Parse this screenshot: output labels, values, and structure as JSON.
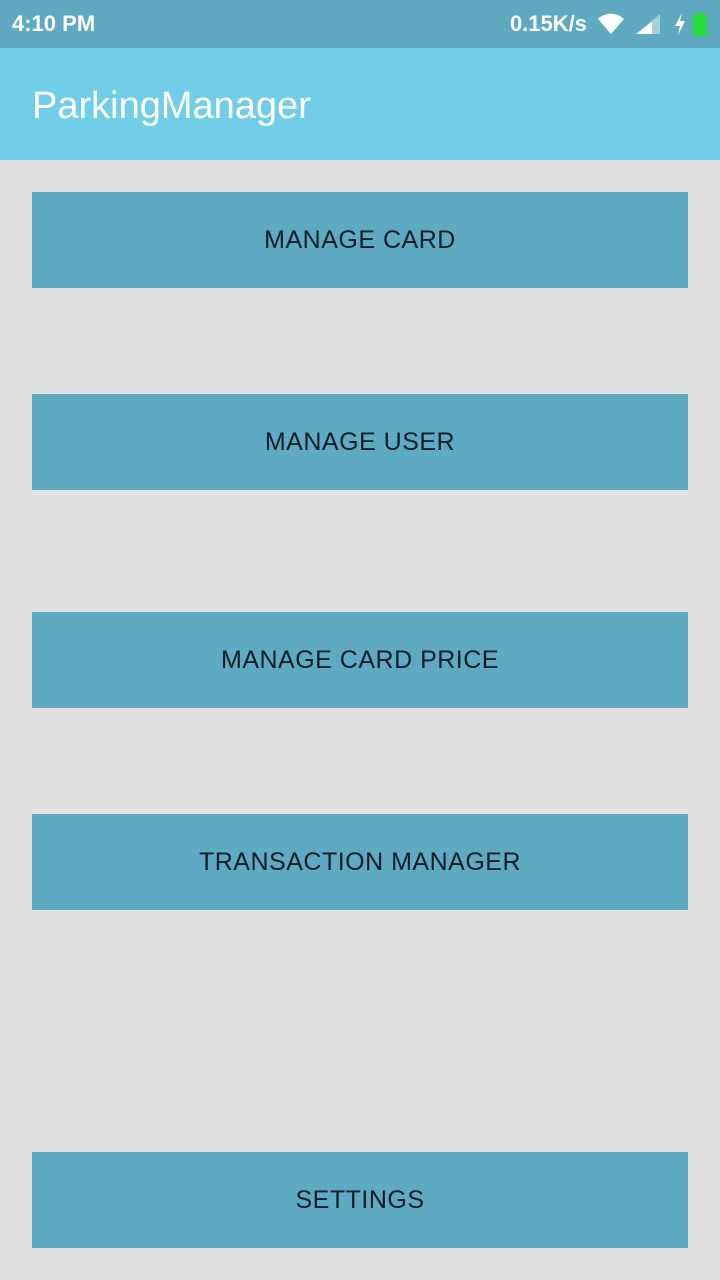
{
  "status_bar": {
    "time": "4:10 PM",
    "network_speed": "0.15K/s",
    "icons": [
      "wifi-icon",
      "signal-icon",
      "charging-bolt-icon",
      "battery-icon"
    ],
    "battery_color": "#27e040"
  },
  "app_bar": {
    "title": "ParkingManager",
    "color": "#71cde8"
  },
  "menu": {
    "button_color": "#5eaac2",
    "background_color": "#e0e0e0",
    "items": [
      {
        "label": "MANAGE CARD"
      },
      {
        "label": "MANAGE USER"
      },
      {
        "label": "MANAGE CARD PRICE"
      },
      {
        "label": "TRANSACTION MANAGER"
      },
      {
        "label": "SETTINGS"
      }
    ]
  }
}
